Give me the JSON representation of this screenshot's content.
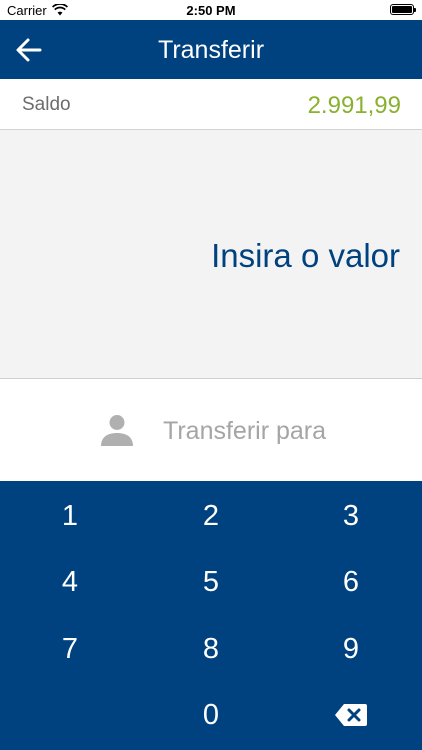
{
  "status_bar": {
    "carrier": "Carrier",
    "time": "2:50 PM"
  },
  "nav": {
    "title": "Transferir",
    "back_icon": "arrow-left-icon"
  },
  "balance": {
    "label": "Saldo",
    "value": "2.991,99",
    "value_color": "#8ab02f"
  },
  "amount": {
    "placeholder": "Insira o valor"
  },
  "recipient": {
    "label": "Transferir para",
    "icon": "person-icon"
  },
  "keypad": {
    "keys": [
      "1",
      "2",
      "3",
      "4",
      "5",
      "6",
      "7",
      "8",
      "9",
      "0"
    ],
    "delete_icon": "backspace-icon"
  },
  "colors": {
    "primary": "#00417f",
    "balance_green": "#8ab02f",
    "muted_text": "#a5a5a5"
  }
}
